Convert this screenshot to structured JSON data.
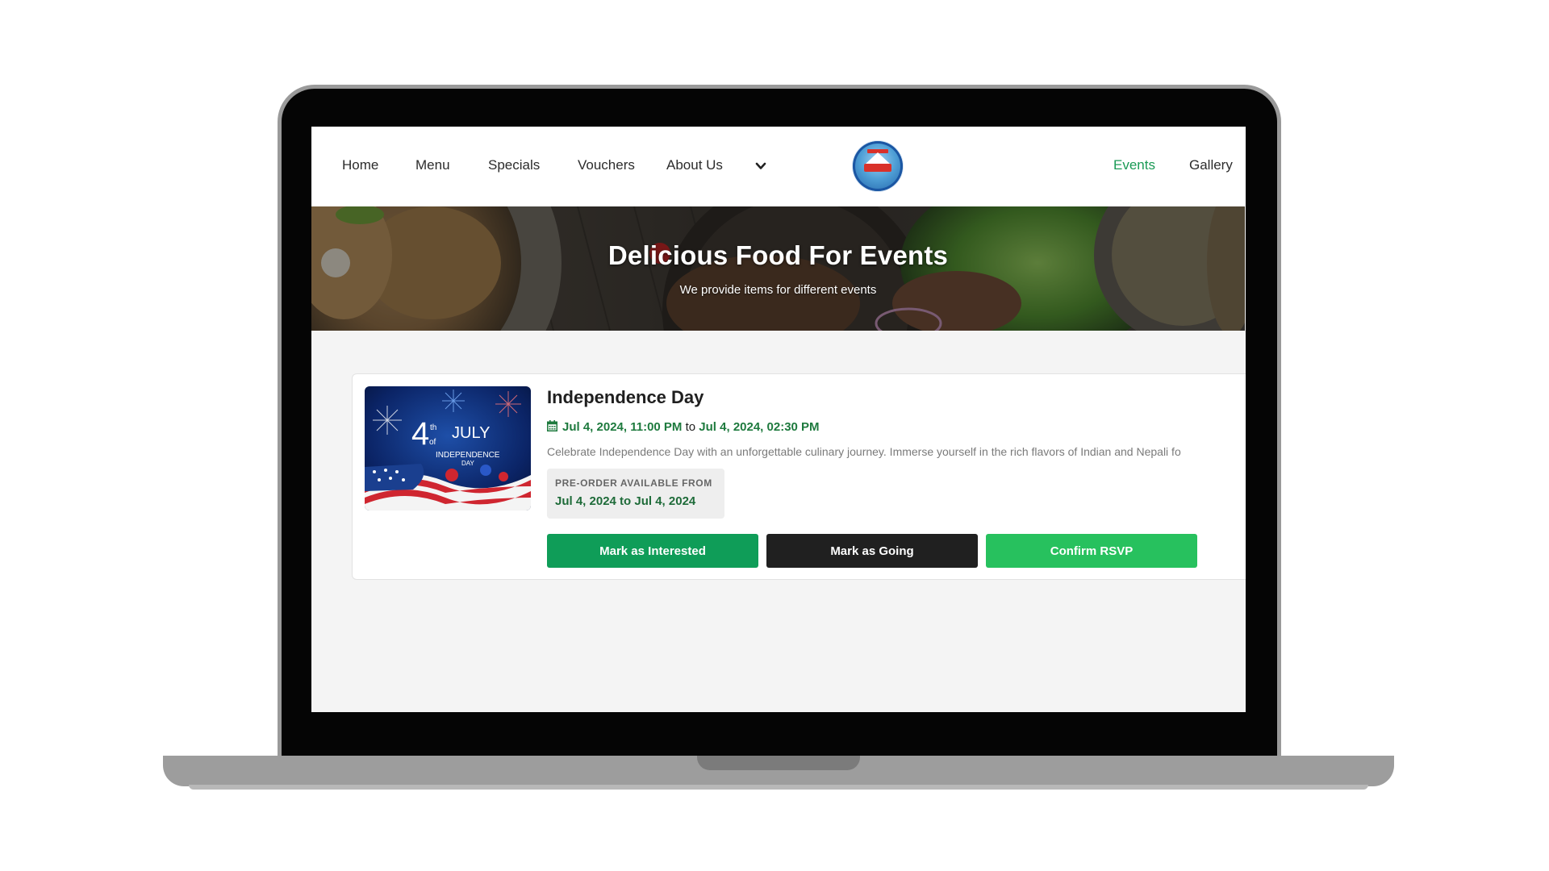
{
  "nav": {
    "left_items": [
      {
        "label": "Home"
      },
      {
        "label": "Menu"
      },
      {
        "label": "Specials"
      },
      {
        "label": "Vouchers"
      },
      {
        "label": "About Us"
      }
    ],
    "right_items": [
      {
        "label": "Events",
        "active": true
      },
      {
        "label": "Gallery"
      }
    ],
    "about_dropdown_icon": "chevron-down-icon",
    "accent_color": "#1a9a55"
  },
  "hero": {
    "title": "Delicious Food For Events",
    "subtitle": "We provide items for different events"
  },
  "event": {
    "title": "Independence Day",
    "calendar_icon": "calendar-icon",
    "start": "Jul 4, 2024, 11:00 PM",
    "to_word": "to",
    "end": "Jul 4, 2024, 02:30 PM",
    "description": "Celebrate Independence Day with an unforgettable culinary journey. Immerse yourself in the rich flavors of Indian and Nepali fo",
    "image_text": {
      "day": "4",
      "suffix": "th",
      "of": "of",
      "month": "JULY",
      "holiday_line1": "INDEPENDENCE",
      "holiday_line2": "DAY"
    },
    "preorder": {
      "label": "PRE-ORDER AVAILABLE FROM",
      "dates": "Jul 4, 2024 to Jul 4, 2024"
    },
    "buttons": {
      "interested": "Mark as Interested",
      "going": "Mark as Going",
      "rsvp": "Confirm RSVP"
    },
    "colors": {
      "interested": "#0f9d58",
      "going": "#202020",
      "rsvp": "#27c15e",
      "date_text": "#1e7a3e"
    }
  }
}
